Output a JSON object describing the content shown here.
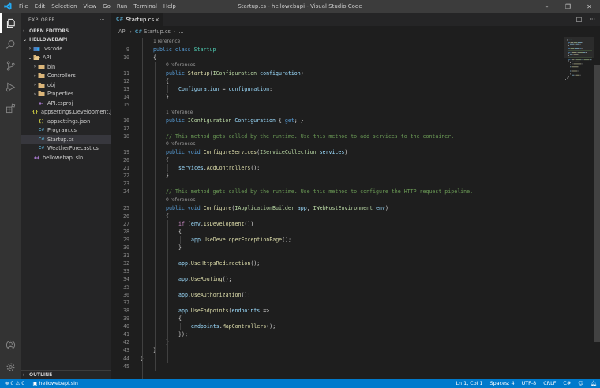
{
  "titlebar": {
    "menu": [
      "File",
      "Edit",
      "Selection",
      "View",
      "Go",
      "Run",
      "Terminal",
      "Help"
    ],
    "title": "Startup.cs - hellowebapi - Visual Studio Code",
    "minimize_icon": "minimize-icon",
    "restore_icon": "restore-icon",
    "close_icon": "close-icon"
  },
  "activity_bar": {
    "icons": [
      "explorer-icon",
      "search-icon",
      "source-control-icon",
      "run-debug-icon",
      "extensions-icon",
      "account-icon",
      "settings-gear-icon"
    ]
  },
  "sidebar": {
    "title": "EXPLORER",
    "more": "···",
    "open_editors": "OPEN EDITORS",
    "root": "HELLOWEBAPI",
    "items": [
      {
        "label": ".vscode",
        "icon": "vscode-folder-icon",
        "chevron": "›",
        "indent": 1
      },
      {
        "label": "API",
        "icon": "folder-open-icon",
        "chevron": "⌄",
        "indent": 1
      },
      {
        "label": "bin",
        "icon": "folder-icon",
        "chevron": "›",
        "indent": 2
      },
      {
        "label": "Controllers",
        "icon": "folder-icon",
        "chevron": "›",
        "indent": 2
      },
      {
        "label": "obj",
        "icon": "folder-icon",
        "chevron": "›",
        "indent": 2
      },
      {
        "label": "Properties",
        "icon": "folder-icon",
        "chevron": "›",
        "indent": 2
      },
      {
        "label": "API.csproj",
        "icon": "csproj-icon",
        "chevron": "",
        "indent": 2
      },
      {
        "label": "appsettings.Development.json",
        "icon": "json-icon",
        "chevron": "",
        "indent": 2
      },
      {
        "label": "appsettings.json",
        "icon": "json-icon",
        "chevron": "",
        "indent": 2
      },
      {
        "label": "Program.cs",
        "icon": "csharp-icon",
        "chevron": "",
        "indent": 2
      },
      {
        "label": "Startup.cs",
        "icon": "csharp-icon",
        "chevron": "",
        "indent": 2,
        "selected": true
      },
      {
        "label": "WeatherForecast.cs",
        "icon": "csharp-icon",
        "chevron": "",
        "indent": 2
      },
      {
        "label": "hellowebapi.sln",
        "icon": "sln-icon",
        "chevron": "",
        "indent": 1
      }
    ],
    "outline": "OUTLINE"
  },
  "editor": {
    "tab": {
      "label": "Startup.cs",
      "lang": "C#",
      "close": "×"
    },
    "breadcrumb": {
      "folder": "API",
      "lang": "C#",
      "file": "Startup.cs",
      "more": "..."
    },
    "lines": [
      {
        "type": "lens",
        "text": "1 reference",
        "indent": 1
      },
      {
        "n": 9,
        "indent": 1,
        "tokens": [
          [
            "kw",
            "public "
          ],
          [
            "kw",
            "class "
          ],
          [
            "ty",
            "Startup"
          ]
        ]
      },
      {
        "n": 10,
        "indent": 1,
        "tokens": [
          [
            "pl",
            "{"
          ]
        ]
      },
      {
        "type": "lens",
        "text": "0 references",
        "indent": 2
      },
      {
        "n": 11,
        "indent": 2,
        "tokens": [
          [
            "kw",
            "public "
          ],
          [
            "fn",
            "Startup"
          ],
          [
            "pl",
            "("
          ],
          [
            "if",
            "IConfiguration "
          ],
          [
            "id",
            "configuration"
          ],
          [
            "pl",
            ")"
          ]
        ]
      },
      {
        "n": 12,
        "indent": 2,
        "tokens": [
          [
            "pl",
            "{"
          ]
        ]
      },
      {
        "n": 13,
        "indent": 3,
        "tokens": [
          [
            "id",
            "Configuration"
          ],
          [
            "pl",
            " = "
          ],
          [
            "id",
            "configuration"
          ],
          [
            "pl",
            ";"
          ]
        ]
      },
      {
        "n": 14,
        "indent": 2,
        "tokens": [
          [
            "pl",
            "}"
          ]
        ]
      },
      {
        "n": 15,
        "indent": 0,
        "tokens": []
      },
      {
        "type": "lens",
        "text": "1 reference",
        "indent": 2
      },
      {
        "n": 16,
        "indent": 2,
        "tokens": [
          [
            "kw",
            "public "
          ],
          [
            "if",
            "IConfiguration "
          ],
          [
            "id",
            "Configuration"
          ],
          [
            "pl",
            " { "
          ],
          [
            "kw",
            "get"
          ],
          [
            "pl",
            "; }"
          ]
        ]
      },
      {
        "n": 17,
        "indent": 0,
        "tokens": []
      },
      {
        "n": 18,
        "indent": 2,
        "tokens": [
          [
            "cm",
            "// This method gets called by the runtime. Use this method to add services to the container."
          ]
        ]
      },
      {
        "type": "lens",
        "text": "0 references",
        "indent": 2
      },
      {
        "n": 19,
        "indent": 2,
        "tokens": [
          [
            "kw",
            "public "
          ],
          [
            "kw",
            "void "
          ],
          [
            "fn",
            "ConfigureServices"
          ],
          [
            "pl",
            "("
          ],
          [
            "if",
            "IServiceCollection "
          ],
          [
            "id",
            "services"
          ],
          [
            "pl",
            ")"
          ]
        ]
      },
      {
        "n": 20,
        "indent": 2,
        "tokens": [
          [
            "pl",
            "{"
          ]
        ]
      },
      {
        "n": 21,
        "indent": 3,
        "tokens": [
          [
            "id",
            "services"
          ],
          [
            "pl",
            "."
          ],
          [
            "fn",
            "AddControllers"
          ],
          [
            "pl",
            "();"
          ]
        ]
      },
      {
        "n": 22,
        "indent": 2,
        "tokens": [
          [
            "pl",
            "}"
          ]
        ]
      },
      {
        "n": 23,
        "indent": 0,
        "tokens": []
      },
      {
        "n": 24,
        "indent": 2,
        "tokens": [
          [
            "cm",
            "// This method gets called by the runtime. Use this method to configure the HTTP request pipeline."
          ]
        ]
      },
      {
        "type": "lens",
        "text": "0 references",
        "indent": 2
      },
      {
        "n": 25,
        "indent": 2,
        "tokens": [
          [
            "kw",
            "public "
          ],
          [
            "kw",
            "void "
          ],
          [
            "fn",
            "Configure"
          ],
          [
            "pl",
            "("
          ],
          [
            "if",
            "IApplicationBuilder "
          ],
          [
            "id",
            "app"
          ],
          [
            "pl",
            ", "
          ],
          [
            "if",
            "IWebHostEnvironment "
          ],
          [
            "id",
            "env"
          ],
          [
            "pl",
            ")"
          ]
        ]
      },
      {
        "n": 26,
        "indent": 2,
        "tokens": [
          [
            "pl",
            "{"
          ]
        ]
      },
      {
        "n": 27,
        "indent": 3,
        "tokens": [
          [
            "ct",
            "if "
          ],
          [
            "pl",
            "("
          ],
          [
            "id",
            "env"
          ],
          [
            "pl",
            "."
          ],
          [
            "fn",
            "IsDevelopment"
          ],
          [
            "pl",
            "())"
          ]
        ]
      },
      {
        "n": 28,
        "indent": 3,
        "tokens": [
          [
            "pl",
            "{"
          ]
        ]
      },
      {
        "n": 29,
        "indent": 4,
        "tokens": [
          [
            "id",
            "app"
          ],
          [
            "pl",
            "."
          ],
          [
            "fn",
            "UseDeveloperExceptionPage"
          ],
          [
            "pl",
            "();"
          ]
        ]
      },
      {
        "n": 30,
        "indent": 3,
        "tokens": [
          [
            "pl",
            "}"
          ]
        ]
      },
      {
        "n": 31,
        "indent": 0,
        "tokens": []
      },
      {
        "n": 32,
        "indent": 3,
        "tokens": [
          [
            "id",
            "app"
          ],
          [
            "pl",
            "."
          ],
          [
            "fn",
            "UseHttpsRedirection"
          ],
          [
            "pl",
            "();"
          ]
        ]
      },
      {
        "n": 33,
        "indent": 0,
        "tokens": []
      },
      {
        "n": 34,
        "indent": 3,
        "tokens": [
          [
            "id",
            "app"
          ],
          [
            "pl",
            "."
          ],
          [
            "fn",
            "UseRouting"
          ],
          [
            "pl",
            "();"
          ]
        ]
      },
      {
        "n": 35,
        "indent": 0,
        "tokens": []
      },
      {
        "n": 36,
        "indent": 3,
        "tokens": [
          [
            "id",
            "app"
          ],
          [
            "pl",
            "."
          ],
          [
            "fn",
            "UseAuthorization"
          ],
          [
            "pl",
            "();"
          ]
        ]
      },
      {
        "n": 37,
        "indent": 0,
        "tokens": []
      },
      {
        "n": 38,
        "indent": 3,
        "tokens": [
          [
            "id",
            "app"
          ],
          [
            "pl",
            "."
          ],
          [
            "fn",
            "UseEndpoints"
          ],
          [
            "pl",
            "("
          ],
          [
            "id",
            "endpoints"
          ],
          [
            "pl",
            " =>"
          ]
        ]
      },
      {
        "n": 39,
        "indent": 3,
        "tokens": [
          [
            "pl",
            "{"
          ]
        ]
      },
      {
        "n": 40,
        "indent": 4,
        "tokens": [
          [
            "id",
            "endpoints"
          ],
          [
            "pl",
            "."
          ],
          [
            "fn",
            "MapControllers"
          ],
          [
            "pl",
            "();"
          ]
        ]
      },
      {
        "n": 41,
        "indent": 3,
        "tokens": [
          [
            "pl",
            "});"
          ]
        ]
      },
      {
        "n": 42,
        "indent": 2,
        "tokens": [
          [
            "pl",
            "}"
          ]
        ]
      },
      {
        "n": 43,
        "indent": 1,
        "tokens": [
          [
            "pl",
            "}"
          ]
        ]
      },
      {
        "n": 44,
        "indent": 0,
        "tokens": [
          [
            "pl",
            "}"
          ]
        ]
      },
      {
        "n": 45,
        "indent": 0,
        "tokens": []
      }
    ]
  },
  "statusbar": {
    "problems": "⊗ 0 ⚠ 0",
    "solution": "hellowebapi.sln",
    "position": "Ln 1, Col 1",
    "spaces": "Spaces: 4",
    "encoding": "UTF-8",
    "eol": "CRLF",
    "language": "C#",
    "feedback_icon": "feedback-icon",
    "bell_icon": "bell-icon"
  },
  "colors": {
    "accent": "#007acc",
    "titlebar": "#3c3c3c",
    "activitybar": "#333333",
    "sidebar": "#252526",
    "editor": "#1e1e1e"
  }
}
